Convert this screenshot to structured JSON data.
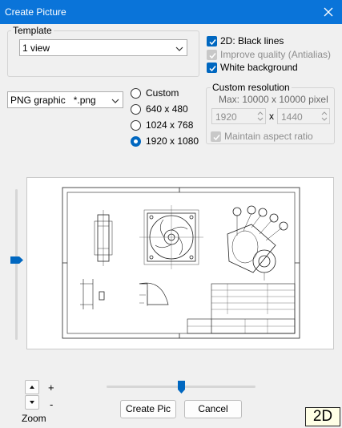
{
  "window": {
    "title": "Create Picture"
  },
  "template": {
    "group_label": "Template",
    "selected": "1 view"
  },
  "options": {
    "black_lines": {
      "label": "2D: Black lines",
      "checked": true
    },
    "improve_quality": {
      "label": "Improve quality (Antialias)",
      "checked": true,
      "disabled": true
    },
    "white_background": {
      "label": "White background",
      "checked": true
    }
  },
  "format": {
    "selected": "PNG graphic   *.png"
  },
  "resolution_options": [
    {
      "label": "Custom",
      "selected": false
    },
    {
      "label": "640 x 480",
      "selected": false
    },
    {
      "label": "1024 x 768",
      "selected": false
    },
    {
      "label": "1920 x 1080",
      "selected": true
    }
  ],
  "custom_resolution": {
    "group_label": "Custom resolution",
    "max_label": "Max: 10000 x 10000 pixel",
    "width": "1920",
    "separator": "x",
    "height": "1440",
    "aspect": {
      "label": "Maintain aspect ratio",
      "checked": true,
      "disabled": true
    }
  },
  "zoom": {
    "plus": "+",
    "minus": "-",
    "label": "Zoom"
  },
  "sliders": {
    "vertical_level": 0.47,
    "horizontal_level": 0.5
  },
  "buttons": {
    "create": "Create Pic",
    "cancel": "Cancel"
  },
  "mode_badge": "2D",
  "colors": {
    "accent": "#0067c0",
    "titlebar": "#0a74d9"
  }
}
